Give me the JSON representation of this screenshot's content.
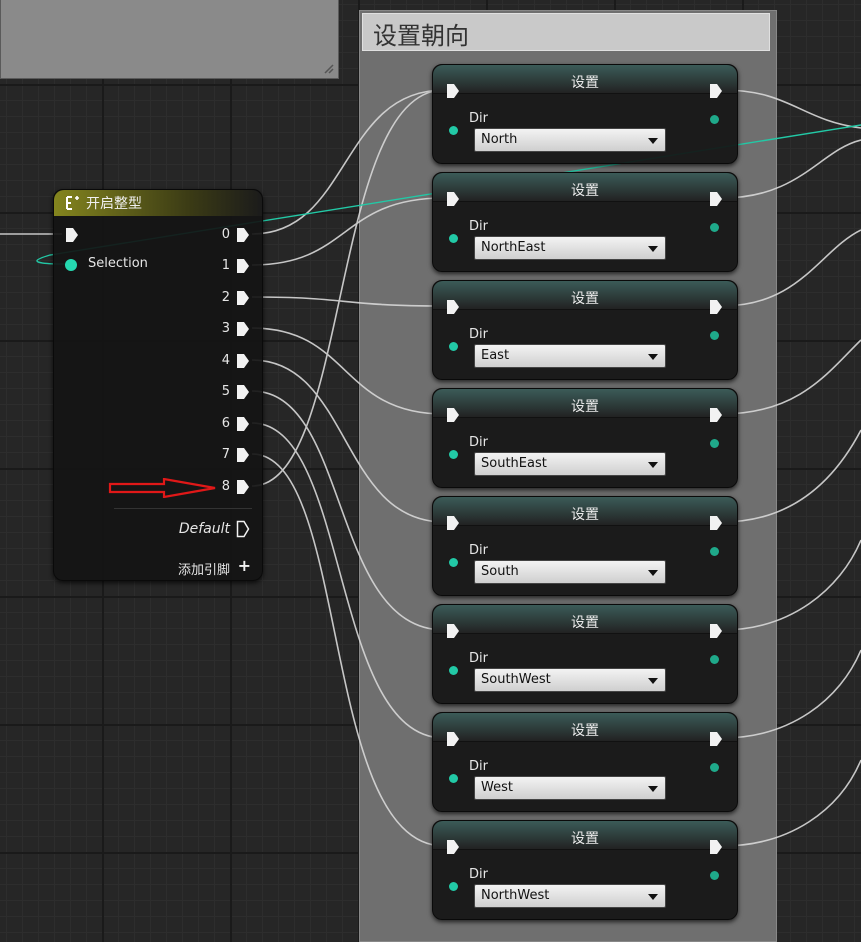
{
  "comment_box": {
    "title": "设置朝向"
  },
  "switch_node": {
    "title": "开启整型",
    "selection_label": "Selection",
    "outputs": [
      "0",
      "1",
      "2",
      "3",
      "4",
      "5",
      "6",
      "7",
      "8"
    ],
    "default_label": "Default",
    "add_pin_label": "添加引脚",
    "add_pin_icon": "+"
  },
  "set_nodes": [
    {
      "title": "设置",
      "dir_label": "Dir",
      "value": "North"
    },
    {
      "title": "设置",
      "dir_label": "Dir",
      "value": "NorthEast"
    },
    {
      "title": "设置",
      "dir_label": "Dir",
      "value": "East"
    },
    {
      "title": "设置",
      "dir_label": "Dir",
      "value": "SouthEast"
    },
    {
      "title": "设置",
      "dir_label": "Dir",
      "value": "South"
    },
    {
      "title": "设置",
      "dir_label": "Dir",
      "value": "SouthWest"
    },
    {
      "title": "设置",
      "dir_label": "Dir",
      "value": "West"
    },
    {
      "title": "设置",
      "dir_label": "Dir",
      "value": "NorthWest"
    }
  ],
  "colors": {
    "exec_wire": "#dcdcdc",
    "data_wire": "#22c9a6",
    "annotation_arrow": "#e01818",
    "switch_header": "#84851e",
    "set_header": "#3b5b58"
  }
}
